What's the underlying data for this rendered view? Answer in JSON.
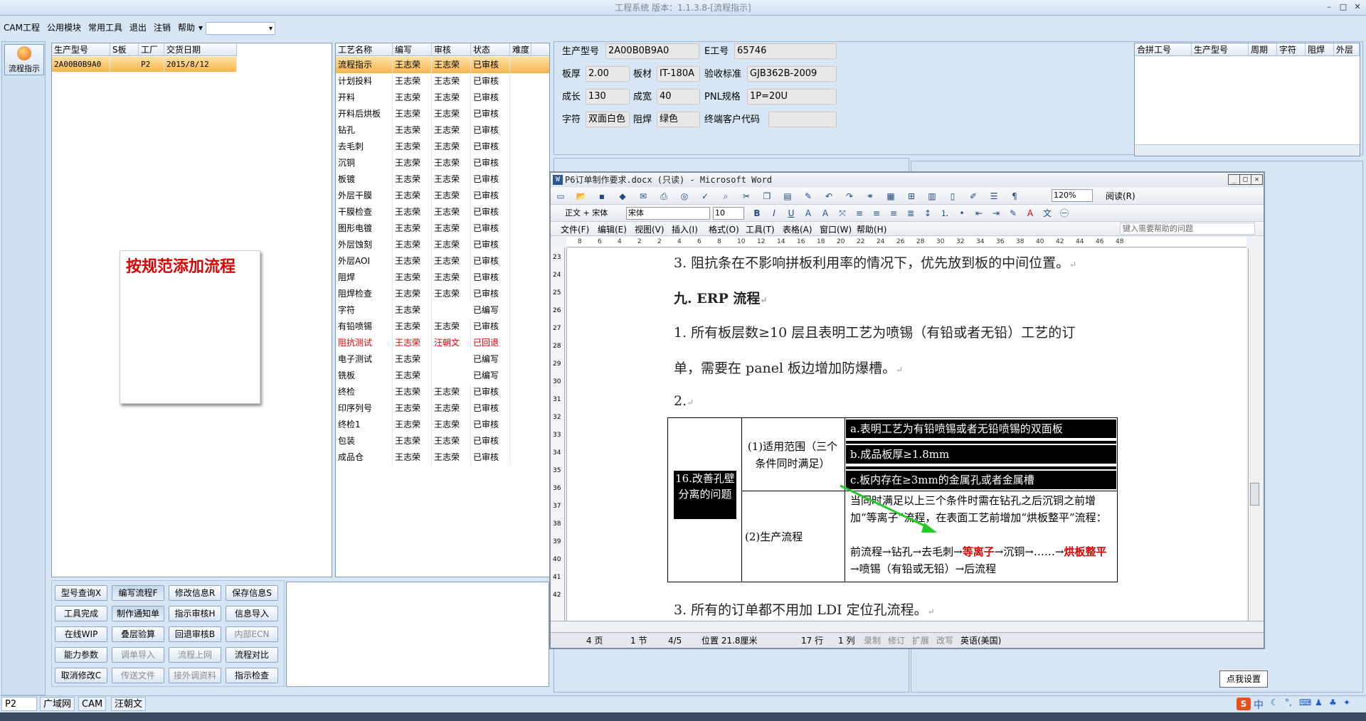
{
  "window": {
    "title": "工程系统 版本：1.1.3.8-[流程指示]"
  },
  "menu": {
    "items": [
      "CAM工程",
      "公用模块",
      "常用工具",
      "退出",
      "注销",
      "帮助"
    ],
    "combo_value": ""
  },
  "leftbar": {
    "flow_label": "流程指示"
  },
  "order_grid": {
    "headers": [
      "生产型号",
      "S板",
      "工厂",
      "交货日期"
    ],
    "rows": [
      [
        "2A00B0B9A0",
        "",
        "P2",
        "2015/8/12"
      ]
    ]
  },
  "note": {
    "text": "按规范添加流程"
  },
  "process_grid": {
    "headers": [
      "工艺名称",
      "编写",
      "审核",
      "状态",
      "难度"
    ],
    "rows": [
      [
        "流程指示",
        "王志荣",
        "王志荣",
        "已审核",
        ""
      ],
      [
        "计划投料",
        "王志荣",
        "王志荣",
        "已审核",
        ""
      ],
      [
        "开料",
        "王志荣",
        "王志荣",
        "已审核",
        ""
      ],
      [
        "开料后烘板",
        "王志荣",
        "王志荣",
        "已审核",
        ""
      ],
      [
        "钻孔",
        "王志荣",
        "王志荣",
        "已审核",
        ""
      ],
      [
        "去毛刺",
        "王志荣",
        "王志荣",
        "已审核",
        ""
      ],
      [
        "沉铜",
        "王志荣",
        "王志荣",
        "已审核",
        ""
      ],
      [
        "板镀",
        "王志荣",
        "王志荣",
        "已审核",
        ""
      ],
      [
        "外层干膜",
        "王志荣",
        "王志荣",
        "已审核",
        ""
      ],
      [
        "干膜检查",
        "王志荣",
        "王志荣",
        "已审核",
        ""
      ],
      [
        "图形电镀",
        "王志荣",
        "王志荣",
        "已审核",
        ""
      ],
      [
        "外层蚀刻",
        "王志荣",
        "王志荣",
        "已审核",
        ""
      ],
      [
        "外层AOI",
        "王志荣",
        "王志荣",
        "已审核",
        ""
      ],
      [
        "阻焊",
        "王志荣",
        "王志荣",
        "已审核",
        ""
      ],
      [
        "阻焊检查",
        "王志荣",
        "王志荣",
        "已审核",
        ""
      ],
      [
        "字符",
        "王志荣",
        "",
        "已编写",
        ""
      ],
      [
        "有铅喷锡",
        "王志荣",
        "王志荣",
        "已审核",
        ""
      ],
      [
        "阻抗测试",
        "王志荣",
        "汪朝文",
        "已回退",
        ""
      ],
      [
        "电子测试",
        "王志荣",
        "",
        "已编写",
        ""
      ],
      [
        "铣板",
        "王志荣",
        "",
        "已编写",
        ""
      ],
      [
        "终检",
        "王志荣",
        "王志荣",
        "已审核",
        ""
      ],
      [
        "印序列号",
        "王志荣",
        "王志荣",
        "已审核",
        ""
      ],
      [
        "终检1",
        "王志荣",
        "王志荣",
        "已审核",
        ""
      ],
      [
        "包装",
        "王志荣",
        "王志荣",
        "已审核",
        ""
      ],
      [
        "成品仓",
        "王志荣",
        "王志荣",
        "已审核",
        ""
      ]
    ]
  },
  "buttons": [
    [
      "型号查询X",
      "编写流程F",
      "修改信息R",
      "保存信息S"
    ],
    [
      "工具完成",
      "制作通知单",
      "指示审核H",
      "信息导入"
    ],
    [
      "在线WIP",
      "叠层验算",
      "回退审核B",
      "内部ECN"
    ],
    [
      "能力参数",
      "调单导入",
      "流程上网",
      "流程对比"
    ],
    [
      "取消修改C",
      "传送文件",
      "接外调资料",
      "指示检查"
    ]
  ],
  "info": {
    "model_label": "生产型号",
    "model_value": "2A00B0B9A0",
    "eno_label": "E工号",
    "eno_value": "65746",
    "thick_label": "板厚",
    "thick_value": "2.00",
    "material_label": "板材",
    "material_value": "IT-180A",
    "standard_label": "验收标准",
    "standard_value": "GJB362B-2009",
    "length_label": "成长",
    "length_value": "130",
    "width_label": "成宽",
    "width_value": "40",
    "pnl_label": "PNL规格",
    "pnl_value": "1P=20U",
    "char_label": "字符",
    "char_value": "双面白色",
    "mask_label": "阻焊",
    "mask_value": "绿色",
    "enduser_label": "终端客户代码",
    "enduser_value": ""
  },
  "merge_grid": {
    "headers": [
      "合拼工号",
      "生产型号",
      "周期",
      "字符",
      "阻焊",
      "外层"
    ]
  },
  "word": {
    "title": "P6订单制作要求.docx (只读) - Microsoft Word",
    "zoom": "120%",
    "read_label": "阅读(R)",
    "style": "正文 + 宋体",
    "font": "宋体",
    "size": "10",
    "menu": [
      "文件(F)",
      "编辑(E)",
      "视图(V)",
      "插入(I)",
      "格式(O)",
      "工具(T)",
      "表格(A)",
      "窗口(W)",
      "帮助(H)"
    ],
    "help_placeholder": "键入需要帮助的问题",
    "ruler_marks": [
      "8",
      "6",
      "4",
      "2",
      "2",
      "4",
      "6",
      "8",
      "10",
      "12",
      "14",
      "16",
      "18",
      "20",
      "22",
      "24",
      "26",
      "28",
      "30",
      "32",
      "34",
      "36",
      "38",
      "40",
      "42",
      "44",
      "46",
      "48"
    ],
    "vruler_marks": [
      "23",
      "24",
      "25",
      "26",
      "27",
      "28",
      "29",
      "30",
      "31",
      "32",
      "33",
      "34",
      "35",
      "36",
      "37",
      "38",
      "39",
      "40",
      "41",
      "42"
    ],
    "lines": {
      "l1": "3. 阻抗条在不影响拼板利用率的情况下，优先放到板的中间位置。",
      "h9": "九. ERP 流程",
      "l2": "1. 所有板层数≥10 层且表明工艺为喷锡（有铅或者无铅）工艺的订",
      "l3": "单，需要在 panel 板边增加防爆槽。",
      "l4": "2.",
      "l5": "3. 所有的订单都不用加 LDI 定位孔流程。"
    },
    "table": {
      "left_cell": "16.改善孔壁分离的问题",
      "scope": "(1)适用范围（三个条件同时满足）",
      "cond_a": "a.表明工艺为有铅喷锡或者无铅喷锡的双面板",
      "cond_b": "b.成品板厚≥1.8mm",
      "cond_c": "c.板内存在≥3mm的金属孔或者金属槽",
      "flow_label": "(2)生产流程",
      "flow_text1": "当同时满足以上三个条件时需在钻孔之后沉铜之前增加“等离子”流程，在表面工艺前增加“烘板整平”流程：",
      "flow_seq_a": "前流程→钻孔→去毛刺→",
      "flow_seq_red1": "等离子",
      "flow_seq_b": "→沉铜→……→",
      "flow_seq_red2": "烘板整平",
      "flow_seq_c": "→喷锡（有铅或无铅）→后流程"
    },
    "status": {
      "page": "4 页",
      "section": "1 节",
      "pages": "4/5",
      "position": "位置 21.8厘米",
      "line": "17 行",
      "col": "1 列",
      "rec": "录制",
      "trk": "修订",
      "ext": "扩展",
      "ovr": "改写",
      "lang": "英语(美国)"
    }
  },
  "tooltip": {
    "text": "点我设置"
  },
  "taskbar": {
    "combo": "P2",
    "tabs": [
      "广域网",
      "CAM",
      "汪朝文"
    ],
    "ime": "中"
  },
  "colors": {
    "accent": "#f7b54b",
    "rollback": "#e00000",
    "arrow": "#22cc22",
    "header_bg": "#dfe9f4"
  }
}
